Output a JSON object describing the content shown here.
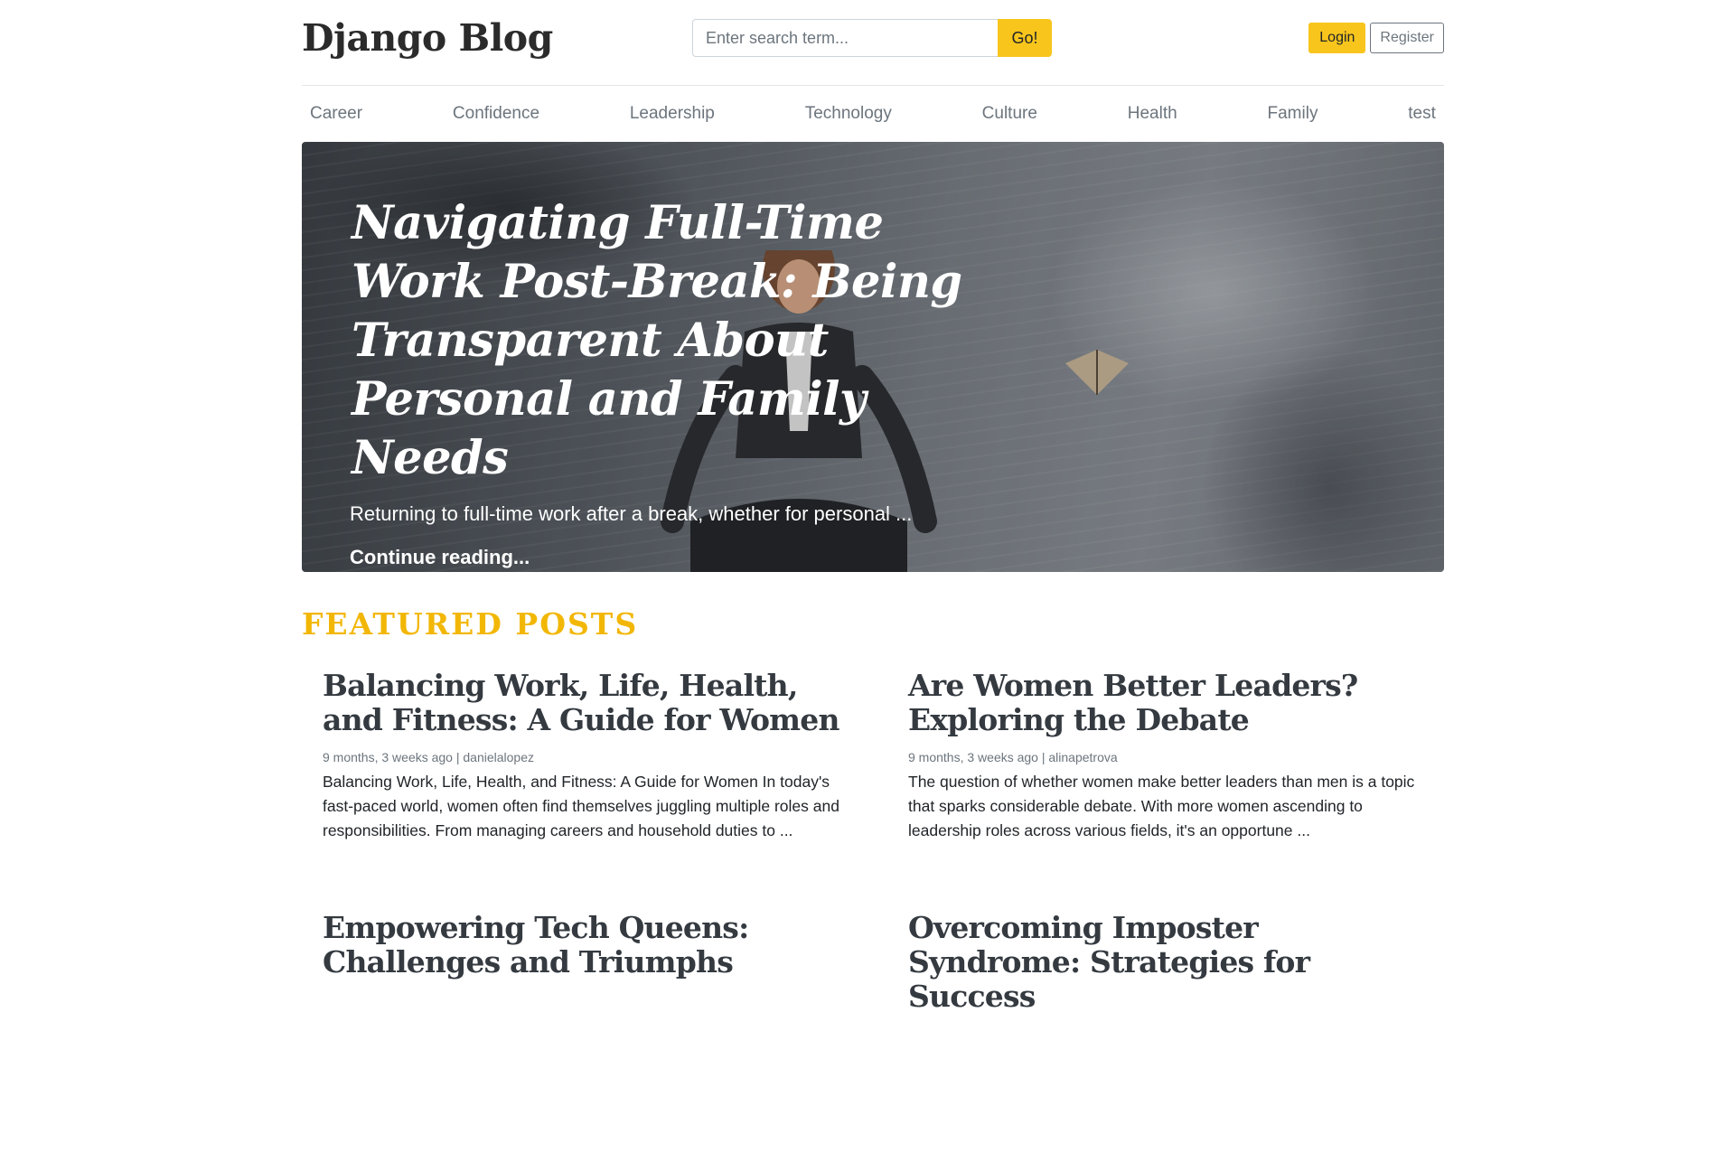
{
  "brand": "Django Blog",
  "search": {
    "placeholder": "Enter search term...",
    "button_label": "Go!"
  },
  "auth": {
    "login_label": "Login",
    "register_label": "Register"
  },
  "nav": [
    "Career",
    "Confidence",
    "Leadership",
    "Technology",
    "Culture",
    "Health",
    "Family",
    "test"
  ],
  "hero": {
    "title": "Navigating Full-Time Work Post-Break: Being Transparent About Personal and Family Needs",
    "lead": "Returning to full-time work after a break, whether for personal ...",
    "link_label": "Continue reading..."
  },
  "featured": {
    "heading": "FEATURED POSTS",
    "posts": [
      {
        "title": "Balancing Work, Life, Health, and Fitness: A Guide for Women",
        "meta": "9 months, 3 weeks ago | danielalopez",
        "excerpt": "Balancing Work, Life, Health, and Fitness: A Guide for Women In today's fast-paced world, women often find themselves juggling multiple roles and responsibilities. From managing careers and household duties to ..."
      },
      {
        "title": "Are Women Better Leaders? Exploring the Debate",
        "meta": "9 months, 3 weeks ago | alinapetrova",
        "excerpt": "The question of whether women make better leaders than men is a topic that sparks considerable debate. With more women ascending to leadership roles across various fields, it's an opportune ..."
      },
      {
        "title": "Empowering Tech Queens: Challenges and Triumphs",
        "meta": "",
        "excerpt": ""
      },
      {
        "title": "Overcoming Imposter Syndrome: Strategies for Success",
        "meta": "",
        "excerpt": ""
      }
    ]
  },
  "colors": {
    "accent": "#f8c51c",
    "heading_accent": "#f2b705",
    "muted": "#6c757d"
  }
}
